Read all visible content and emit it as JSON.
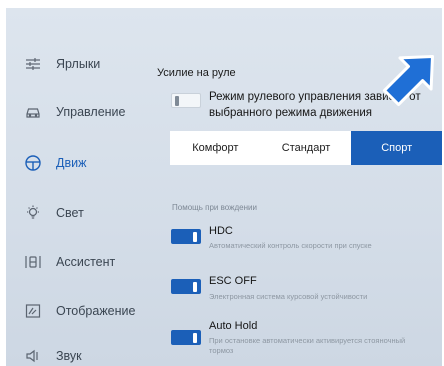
{
  "colors": {
    "accent": "#1b5fb8",
    "panel_bg": "#d6dfe9",
    "text": "#3b4652"
  },
  "sidebar": {
    "items": [
      {
        "label": "Ярлыки",
        "icon": "sliders-icon",
        "active": false
      },
      {
        "label": "Управление",
        "icon": "car-icon",
        "active": false
      },
      {
        "label": "Движ",
        "icon": "steering-wheel-icon",
        "active": true
      },
      {
        "label": "Свет",
        "icon": "light-bulb-icon",
        "active": false
      },
      {
        "label": "Ассистент",
        "icon": "driver-assist-icon",
        "active": false
      },
      {
        "label": "Отображение",
        "icon": "display-icon",
        "active": false
      },
      {
        "label": "Звук",
        "icon": "speaker-icon",
        "active": false
      }
    ]
  },
  "steering": {
    "title": "Усилие на руле",
    "mode_toggle": {
      "state": "off",
      "label": "Режим рулевого управления зависит от выбранного режима движения"
    },
    "segments": [
      "Комфорт",
      "Стандарт",
      "Спорт"
    ],
    "selected": "Спорт"
  },
  "assist": {
    "title": "Помощь при вождении",
    "items": [
      {
        "title": "HDC",
        "desc": "Автоматический контроль скорости при спуске",
        "state": "on"
      },
      {
        "title": "ESC OFF",
        "desc": "Электронная система курсовой устойчивости",
        "state": "on"
      },
      {
        "title": "Auto Hold",
        "desc": "При остановке автоматически активируется стояночный тормоз",
        "state": "on"
      }
    ]
  },
  "annotation": {
    "icon": "pointer-arrow-icon"
  }
}
